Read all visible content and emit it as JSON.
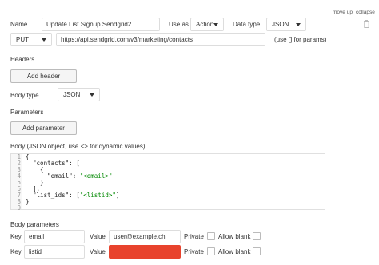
{
  "header": {
    "name_label": "Name",
    "name_value": "Update List Signup Sendgrid2",
    "use_as_label": "Use as",
    "use_as_value": "Action",
    "data_type_label": "Data type",
    "data_type_value": "JSON",
    "move_up": "move up",
    "collapse": "collapse"
  },
  "request": {
    "method": "PUT",
    "url": "https://api.sendgrid.com/v3/marketing/contacts",
    "url_hint": "(use [] for params)"
  },
  "headers_section": {
    "title": "Headers",
    "add_button": "Add header"
  },
  "body_type": {
    "label": "Body type",
    "value": "JSON"
  },
  "parameters_section": {
    "title": "Parameters",
    "add_button": "Add parameter"
  },
  "body": {
    "title": "Body (JSON object, use <> for dynamic values)",
    "line_numbers": [
      "1",
      "2",
      "3",
      "4",
      "5",
      "6",
      "7",
      "8",
      "9"
    ],
    "lines": [
      "{",
      "  \"contacts\": [",
      "    {",
      "      \"email\": \"<email>\"",
      "    }",
      "  ],",
      "  \"list_ids\": [\"<listid>\"]",
      "}",
      ""
    ]
  },
  "body_parameters": {
    "title": "Body parameters",
    "rows": [
      {
        "key_label": "Key",
        "key": "email",
        "value_label": "Value",
        "value": "user@example.ch",
        "private_label": "Private",
        "allow_blank_label": "Allow blank"
      },
      {
        "key_label": "Key",
        "key": "listid",
        "value_label": "Value",
        "value": "",
        "private_label": "Private",
        "allow_blank_label": "Allow blank"
      }
    ]
  },
  "colors": {
    "redacted": "#e8432d",
    "code_string": "#008800"
  }
}
